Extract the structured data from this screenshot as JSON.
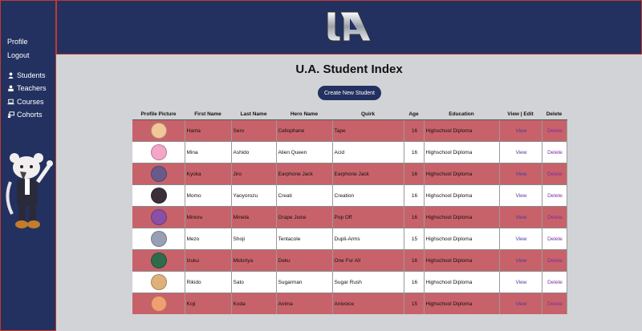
{
  "sidebar": {
    "profile": "Profile",
    "logout": "Logout",
    "nav": [
      {
        "label": "Students",
        "icon": "user-icon"
      },
      {
        "label": "Teachers",
        "icon": "teacher-icon"
      },
      {
        "label": "Courses",
        "icon": "laptop-icon"
      },
      {
        "label": "Cohorts",
        "icon": "cohort-icon"
      }
    ]
  },
  "header": {
    "logo_text": "UA",
    "logo_icon": "ua-logo"
  },
  "main": {
    "title": "U.A. Student Index",
    "create_button": "Create New Student",
    "columns": [
      "Profile Picture",
      "First Name",
      "Last Name",
      "Hero Name",
      "Quirk",
      "Age",
      "Education",
      "View | Edit",
      "Delete"
    ],
    "rows": [
      {
        "first": "Hanta",
        "last": "Sero",
        "hero": "Cellophane",
        "quirk": "Tape",
        "age": "16",
        "education": "Highschool Diploma",
        "view": "View",
        "delete": "Delete",
        "avatar_color": "#f2c89a"
      },
      {
        "first": "Mina",
        "last": "Ashido",
        "hero": "Alien Queen",
        "quirk": "Acid",
        "age": "16",
        "education": "Highschool Diploma",
        "view": "View",
        "delete": "Delete",
        "avatar_color": "#f3a6c8"
      },
      {
        "first": "Kyoka",
        "last": "Jiro",
        "hero": "Earphone Jack",
        "quirk": "Earphone Jack",
        "age": "16",
        "education": "Highschool Diploma",
        "view": "View",
        "delete": "Delete",
        "avatar_color": "#6a5a8c"
      },
      {
        "first": "Momo",
        "last": "Yaoyorozu",
        "hero": "Creati",
        "quirk": "Creation",
        "age": "16",
        "education": "Highschool Diploma",
        "view": "View",
        "delete": "Delete",
        "avatar_color": "#3b2f3a"
      },
      {
        "first": "Minoru",
        "last": "Mineta",
        "hero": "Grape Juice",
        "quirk": "Pop Off",
        "age": "16",
        "education": "Highschool Diploma",
        "view": "View",
        "delete": "Delete",
        "avatar_color": "#8a4fa6"
      },
      {
        "first": "Mezo",
        "last": "Shoji",
        "hero": "Tentacole",
        "quirk": "Dupli-Arms",
        "age": "15",
        "education": "Highschool Diploma",
        "view": "View",
        "delete": "Delete",
        "avatar_color": "#9aa0b4"
      },
      {
        "first": "Izuku",
        "last": "Midoriya",
        "hero": "Deku",
        "quirk": "One For All",
        "age": "16",
        "education": "Highschool Diploma",
        "view": "View",
        "delete": "Delete",
        "avatar_color": "#2f6b4a"
      },
      {
        "first": "Rikido",
        "last": "Sato",
        "hero": "Sugarman",
        "quirk": "Sugar Rush",
        "age": "16",
        "education": "Highschool Diploma",
        "view": "View",
        "delete": "Delete",
        "avatar_color": "#e0b07a"
      },
      {
        "first": "Koji",
        "last": "Koda",
        "hero": "Anima",
        "quirk": "Anivoice",
        "age": "15",
        "education": "Highschool Diploma",
        "view": "View",
        "delete": "Delete",
        "avatar_color": "#f0a070"
      }
    ]
  },
  "colors": {
    "navy": "#233160",
    "row_red": "#c8626a",
    "row_white": "#ffffff",
    "background": "#d1d3d6"
  }
}
